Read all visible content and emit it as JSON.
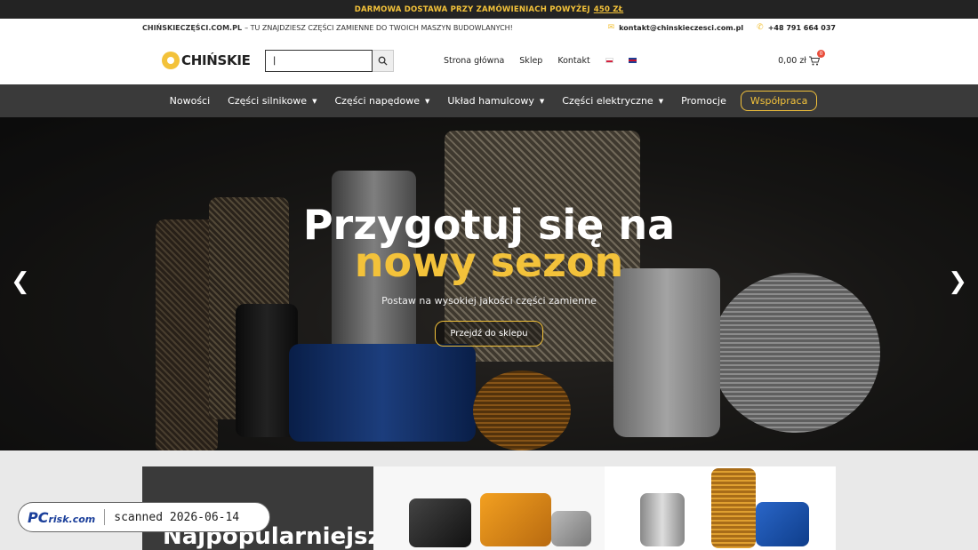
{
  "promo": {
    "text": "DARMOWA DOSTAWA PRZY ZAMÓWIENIACH POWYŻEJ",
    "amount": "450 ZŁ"
  },
  "topbar": {
    "brand": "CHIŃSKIECZĘŚCI.COM.PL",
    "tagline": "– TU ZNAJDZIESZ CZĘŚCI ZAMIENNE DO TWOICH MASZYN BUDOWLANYCH!",
    "email": "kontakt@chinskieczesci.com.pl",
    "phone": "+48 791 664 037"
  },
  "header": {
    "logo_text": "CHIŃSKIE",
    "search_value": "|",
    "nav": [
      "Strona główna",
      "Sklep",
      "Kontakt"
    ],
    "cart_total": "0,00 zł",
    "cart_count": "0"
  },
  "mainnav": {
    "items": [
      "Nowości",
      "Części silnikowe",
      "Części napędowe",
      "Układ hamulcowy",
      "Części elektryczne",
      "Promocje"
    ],
    "cta": "Współpraca"
  },
  "hero": {
    "line1": "Przygotuj się na",
    "line2": "nowy sezon",
    "subtitle": "Postaw na wysokiej jakości części zamienne",
    "button": "Przejdź do sklepu"
  },
  "cards": {
    "first_title": "Najpopularniejsze"
  },
  "watermark": {
    "logo": "PC",
    "logo_suffix": "risk.com",
    "text": "scanned 2026-06-14"
  },
  "colors": {
    "accent": "#f3c23a",
    "dark": "#3a3a3a"
  }
}
